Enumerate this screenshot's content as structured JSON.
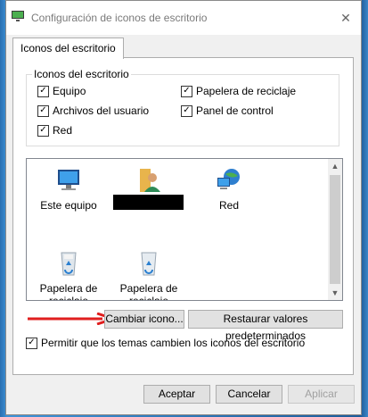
{
  "window": {
    "title": "Configuración de iconos de escritorio",
    "close_glyph": "✕"
  },
  "tabs": [
    "Iconos del escritorio"
  ],
  "desktop_icons_group": {
    "title": "Iconos del escritorio",
    "checkboxes": [
      {
        "label": "Equipo",
        "checked": true
      },
      {
        "label": "Papelera de reciclaje",
        "checked": true
      },
      {
        "label": "Archivos del usuario",
        "checked": true
      },
      {
        "label": "Panel de control",
        "checked": true
      },
      {
        "label": "Red",
        "checked": true
      }
    ]
  },
  "icon_list": {
    "items": [
      {
        "label": "Este equipo",
        "icon": "computer-icon"
      },
      {
        "label": "",
        "icon": "user-folder-icon",
        "redacted": true
      },
      {
        "label": "Red",
        "icon": "network-icon"
      },
      {
        "label": "Papelera de reciclaje (llena)",
        "icon": "recycle-bin-full-icon"
      },
      {
        "label": "Papelera de reciclaje (vacía)",
        "icon": "recycle-bin-empty-icon"
      }
    ]
  },
  "buttons": {
    "change_icon": "Cambiar icono...",
    "restore_defaults": "Restaurar valores predeterminados",
    "accept": "Aceptar",
    "cancel": "Cancelar",
    "apply": "Aplicar"
  },
  "theme_checkbox": {
    "label": "Permitir que los temas cambien los iconos del escritorio",
    "checked": true
  },
  "check_glyph": "✓",
  "colors": {
    "arrow": "#e01e1e",
    "desktop_bg": "#2a6fb0"
  }
}
